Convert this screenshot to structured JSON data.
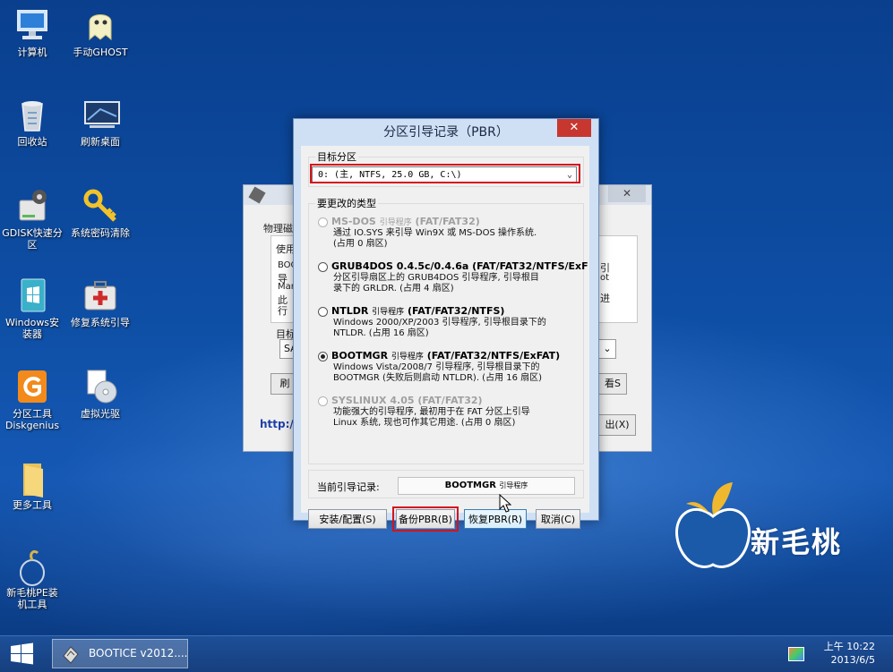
{
  "desktop": {
    "icons": [
      {
        "label": "计算机"
      },
      {
        "label": "手动GHOST"
      },
      {
        "label": "回收站"
      },
      {
        "label": "刷新桌面"
      },
      {
        "label": "GDISK快速分区"
      },
      {
        "label": "系统密码清除"
      },
      {
        "label": "Windows安装器"
      },
      {
        "label": "修复系统引导"
      },
      {
        "label": "分区工具Diskgenius"
      },
      {
        "label": "虚拟光驱"
      },
      {
        "label": "更多工具"
      },
      {
        "label": "新毛桃PE装机工具"
      }
    ],
    "brand": "新毛桃"
  },
  "background_window": {
    "group_label": "物理磁",
    "use_label": "使用",
    "lines": [
      "BOO",
      "导",
      "Mar",
      "此",
      "行"
    ],
    "right_lines": [
      "引",
      "ot",
      "进"
    ],
    "target_label": "目标",
    "select_prefix": "SA",
    "refresh": "刷",
    "view": "看S",
    "link": "http:/",
    "exit": "出(X)",
    "close": "✕"
  },
  "dialog": {
    "title": "分区引导记录（PBR）",
    "close": "✕",
    "target_group": "目标分区",
    "target_value": "0: (主,  NTFS,  25.0 GB, C:\\)",
    "type_group": "要更改的类型",
    "options": [
      {
        "title": "MS-DOS",
        "tag": "引导程序",
        "fs": "(FAT/FAT32)",
        "desc": "通过 IO.SYS 来引导 Win9X 或 MS-DOS 操作系统.\n(占用 0 扇区)",
        "enabled": false,
        "checked": false
      },
      {
        "title": "GRUB4DOS 0.4.5c/0.4.6a",
        "tag": "",
        "fs": "(FAT/FAT32/NTFS/ExF",
        "desc": "分区引导扇区上的 GRUB4DOS 引导程序, 引导根目\n录下的 GRLDR. (占用 4 扇区)",
        "enabled": true,
        "checked": false
      },
      {
        "title": "NTLDR",
        "tag": "引导程序",
        "fs": "(FAT/FAT32/NTFS)",
        "desc": "Windows 2000/XP/2003 引导程序, 引导根目录下的\nNTLDR. (占用 16 扇区)",
        "enabled": true,
        "checked": false
      },
      {
        "title": "BOOTMGR",
        "tag": "引导程序",
        "fs": "(FAT/FAT32/NTFS/ExFAT)",
        "desc": "Windows Vista/2008/7 引导程序, 引导根目录下的\nBOOTMGR (失败后则启动 NTLDR). (占用 16 扇区)",
        "enabled": true,
        "checked": true
      },
      {
        "title": "SYSLINUX 4.05",
        "tag": "",
        "fs": "(FAT/FAT32)",
        "desc": "功能强大的引导程序, 最初用于在 FAT 分区上引导\nLinux 系统, 现也可作其它用途. (占用 0 扇区)",
        "enabled": false,
        "checked": false
      }
    ],
    "current_label": "当前引导记录:",
    "current_value": "BOOTMGR",
    "current_tag": "引导程序",
    "buttons": {
      "install": "安装/配置(S)",
      "backup": "备份PBR(B)",
      "restore": "恢复PBR(R)",
      "cancel": "取消(C)"
    }
  },
  "taskbar": {
    "item": "BOOTICE v2012....",
    "time": "上午 10:22",
    "date": "2013/6/5"
  }
}
